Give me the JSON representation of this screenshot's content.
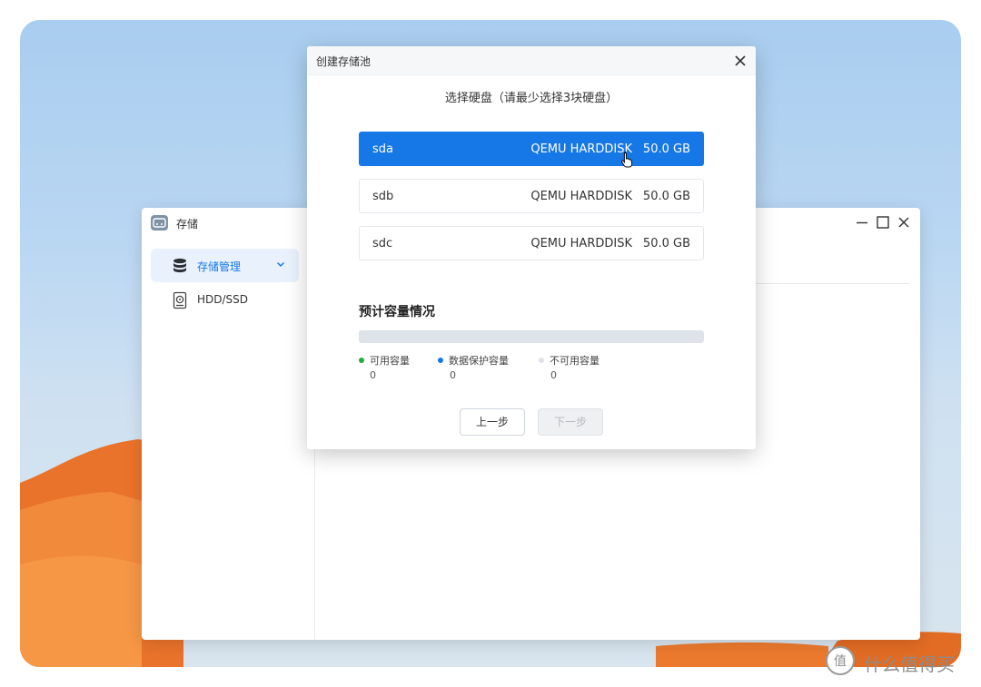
{
  "storage_app": {
    "title": "存储",
    "sidebar": [
      {
        "label": "存储管理",
        "icon": "database-icon",
        "active": true,
        "expanded": true
      },
      {
        "label": "HDD/SSD",
        "icon": "hard-drive-icon",
        "active": false
      }
    ]
  },
  "dialog": {
    "title": "创建存储池",
    "subtitle": "选择硬盘（请最少选择3块硬盘）",
    "disks": [
      {
        "name": "sda",
        "model": "QEMU HARDDISK",
        "size": "50.0 GB",
        "selected": true
      },
      {
        "name": "sdb",
        "model": "QEMU HARDDISK",
        "size": "50.0 GB",
        "selected": false
      },
      {
        "name": "sdc",
        "model": "QEMU HARDDISK",
        "size": "50.0 GB",
        "selected": false
      }
    ],
    "capacity": {
      "title": "预计容量情况",
      "fill_fraction": 0,
      "legend": [
        {
          "label": "可用容量",
          "value": "0",
          "color": "#27a844"
        },
        {
          "label": "数据保护容量",
          "value": "0",
          "color": "#1677e6"
        },
        {
          "label": "不可用容量",
          "value": "0",
          "color": "#dde3e9"
        }
      ]
    },
    "buttons": {
      "prev": "上一步",
      "next": "下一步",
      "next_disabled": true
    }
  },
  "watermark": {
    "text": "什么值得买",
    "badge": "值"
  },
  "colors": {
    "accent": "#1677e6",
    "available": "#27a844",
    "unavailable": "#dde3e9"
  }
}
